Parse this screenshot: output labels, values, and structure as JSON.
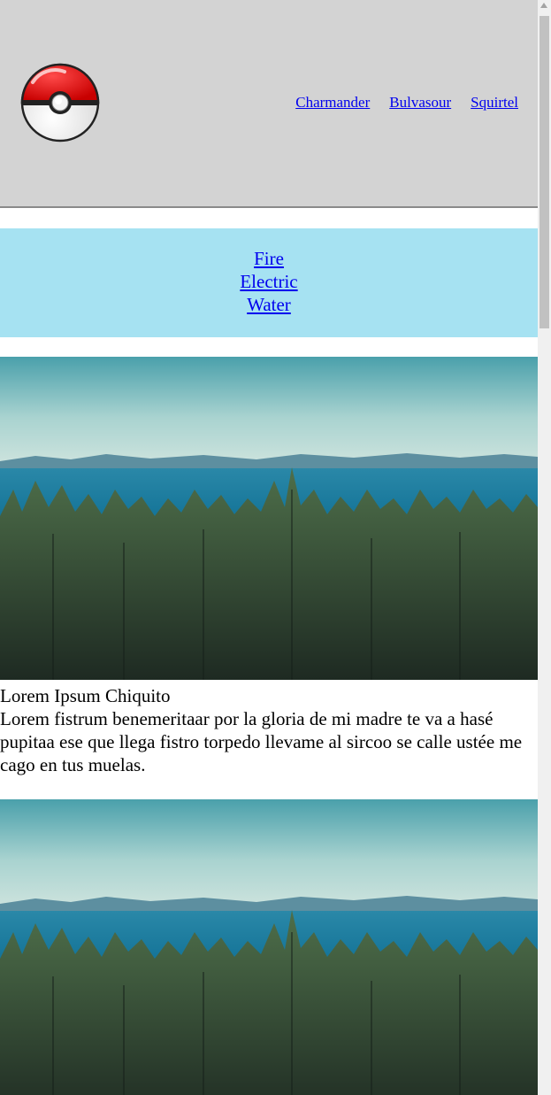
{
  "header": {
    "logo_icon": "pokeball-icon",
    "nav": [
      {
        "label": "Charmander"
      },
      {
        "label": "Bulvasour"
      },
      {
        "label": "Squirtel"
      }
    ]
  },
  "type_nav": {
    "items": [
      {
        "label": "Fire"
      },
      {
        "label": "Electric"
      },
      {
        "label": "Water"
      }
    ]
  },
  "articles": [
    {
      "image": "forest-lake-landscape",
      "title": "Lorem Ipsum Chiquito",
      "body": "Lorem fistrum benemeritaar por la gloria de mi madre te va a hasé pupitaa ese que llega fistro torpedo llevame al sircoo se calle ustée me cago en tus muelas."
    },
    {
      "image": "forest-lake-landscape"
    }
  ],
  "colors": {
    "header_bg": "#d3d3d3",
    "type_band_bg": "#a6e2f2",
    "link": "#0000ee"
  }
}
